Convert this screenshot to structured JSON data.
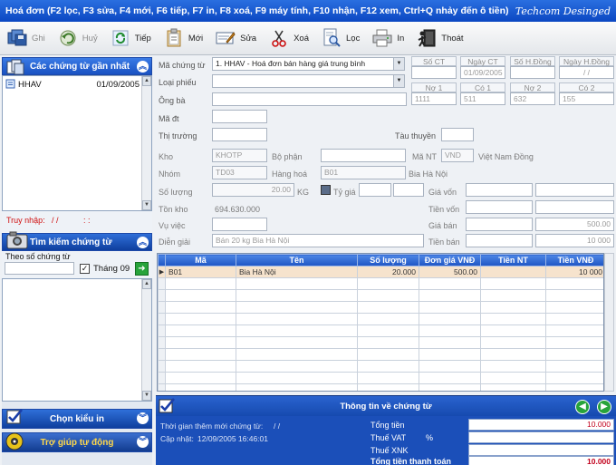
{
  "window": {
    "title": "Hoá đơn (F2 lọc, F3 sửa, F4 mới, F6 tiếp, F7 in, F8 xoá, F9 máy tính, F10 nhận, F12 xem, Ctrl+Q nhảy đến ô tiền)",
    "brand": "Techcom Desinged"
  },
  "toolbar": [
    {
      "label": "Ghi",
      "icon": "floppy-disks-icon",
      "enabled": false
    },
    {
      "label": "Huỷ",
      "icon": "undo-icon",
      "enabled": false
    },
    {
      "label": "Tiếp",
      "icon": "refresh-icon",
      "enabled": true
    },
    {
      "label": "Mới",
      "icon": "clipboard-icon",
      "enabled": true
    },
    {
      "label": "Sửa",
      "icon": "edit-icon",
      "enabled": true
    },
    {
      "label": "Xoá",
      "icon": "scissors-icon",
      "enabled": true
    },
    {
      "label": "Lọc",
      "icon": "filter-icon",
      "enabled": true
    },
    {
      "label": "In",
      "icon": "printer-icon",
      "enabled": true
    },
    {
      "label": "Thoát",
      "icon": "exit-icon",
      "enabled": true
    }
  ],
  "left": {
    "recent_title": "Các chứng từ gần nhất",
    "recent_items": [
      {
        "code": "HHAV",
        "date": "01/09/2005"
      }
    ],
    "access_label": "Truy nhập:",
    "access_value": "/ /",
    "access_time": ":  :",
    "search_title": "Tìm kiếm chứng từ",
    "search_label": "Theo số chứng từ",
    "search_value": "",
    "month_label": "Tháng 09",
    "month_checked": true,
    "choose_title": "Chọn kiểu in",
    "help_title": "Trợ giúp tự động"
  },
  "form": {
    "ma_chung_tu_label": "Mã chứng từ",
    "ma_chung_tu_value": "1. HHAV - Hoá đơn bán hàng giá trung bình",
    "loai_phieu_label": "Loại phiếu",
    "loai_phieu_value": "",
    "ong_ba_label": "Ông bà",
    "ma_dt_label": "Mã đt",
    "thi_truong_label": "Thị trường",
    "tau_thuyen_label": "Tàu thuyền",
    "kho_label": "Kho",
    "kho_value": "KHOTP",
    "bo_phan_label": "Bộ phận",
    "ma_nt_label": "Mã NT",
    "ma_nt_value": "VND",
    "currency_name": "Việt Nam Đồng",
    "nhom_label": "Nhóm",
    "nhom_value": "TD03",
    "hang_hoa_label": "Hàng hoá",
    "hang_hoa_value": "B01",
    "hang_hoa_name": "Bia Hà Nội",
    "so_luong_label": "Số lượng",
    "so_luong_value": "20.00",
    "unit": "KG",
    "ty_gia_label": "Tỷ giá",
    "ty_gia_checked": false,
    "gia_von_label": "Giá vốn",
    "ton_kho_label": "Tồn kho",
    "ton_kho_value": "694.630.000",
    "tien_von_label": "Tiền vốn",
    "vu_viec_label": "Vụ việc",
    "gia_ban_label": "Giá bán",
    "gia_ban_value": "500.00",
    "dien_giai_label": "Diễn giải",
    "dien_giai_value": "Bán 20 kg Bia Hà Nội",
    "tien_ban_label": "Tiền bán",
    "tien_ban_value": "10 000"
  },
  "header_grid": {
    "so_ct": "Số CT",
    "ngay_ct": "Ngày CT",
    "ngay_ct_value": "01/09/2005",
    "so_hd": "Số H.Đồng",
    "ngay_hd": "Ngày H.Đồng",
    "ngay_hd_value": "/ /",
    "no1": "Nợ 1",
    "no1_value": "1111",
    "co1": "Có 1",
    "co1_value": "511",
    "no2": "Nợ 2",
    "no2_value": "632",
    "co2": "Có 2",
    "co2_value": "155"
  },
  "grid": {
    "columns": [
      "Mã",
      "Tên",
      "Số lượng",
      "Đơn giá VNĐ",
      "Tiền NT",
      "Tiền VNĐ"
    ],
    "rows": [
      [
        "B01",
        "Bia Hà Nội",
        "20.000",
        "500.00",
        "",
        "10 000"
      ]
    ],
    "empty_rows": 10
  },
  "info": {
    "title": "Thông tin về chứng từ",
    "created_label": "Thời gian thêm mới chứng từ:",
    "created_value": "/ /",
    "updated_label": "Cập nhật:",
    "updated_value": "12/09/2005 16:46:01",
    "tong_tien_label": "Tổng tiền",
    "tong_tien_value": "10.000",
    "thue_vat_label": "Thuế VAT",
    "thue_vat_pct": "%",
    "thue_xnk_label": "Thuế XNK",
    "tong_tt_label": "Tổng tiền thanh toán",
    "tong_tt_value": "10.000"
  },
  "colors": {
    "title_blue": "#0b47c2",
    "header_blue": "#1f55c4",
    "selected_row": "#f6e3cd",
    "amount_red": "#c1001c"
  }
}
